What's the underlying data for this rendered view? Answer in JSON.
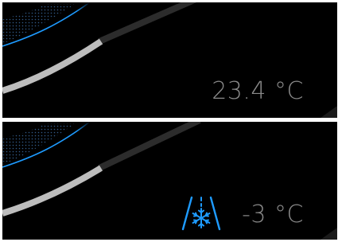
{
  "colors": {
    "background": "#000000",
    "accent_blue": "#1e9bff",
    "temperature_text": "#8a8a8a",
    "gauge_light": "#bdbdbd",
    "gauge_dark": "#2c2c2c"
  },
  "displays": [
    {
      "temperature": "23.4 °C",
      "warning_icon": null
    },
    {
      "temperature": "-3 °C",
      "warning_icon": "frost-road-warning-icon"
    }
  ]
}
